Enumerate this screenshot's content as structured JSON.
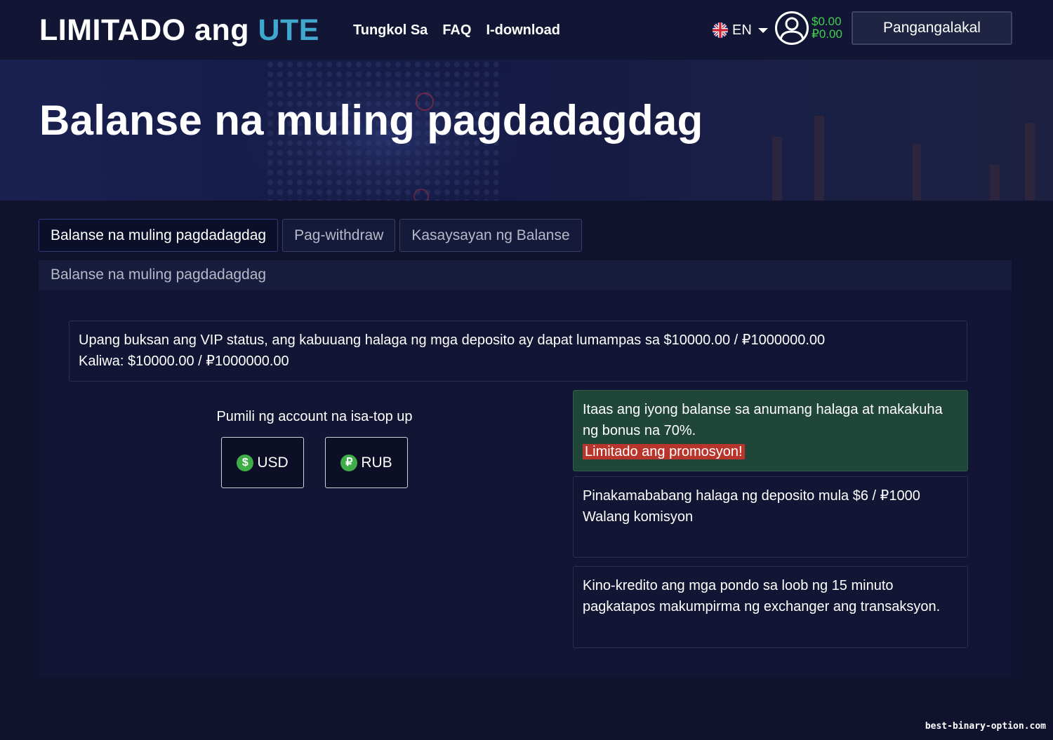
{
  "header": {
    "logo_main": "LIMITADO ang ",
    "logo_accent": "UTE",
    "nav": [
      "Tungkol Sa",
      "FAQ",
      "I-download"
    ],
    "language": "EN",
    "balance_usd": "$0.00",
    "balance_rub": "₽0.00",
    "trade_button": "Pangangalakal",
    "icons": {
      "flag": "uk-flag-icon",
      "caret": "caret-down-icon",
      "avatar": "user-avatar-icon"
    }
  },
  "hero": {
    "title": "Balanse na muling pagdadagdag"
  },
  "tabs": [
    {
      "label": "Balanse na muling pagdadagdag",
      "active": true
    },
    {
      "label": "Pag-withdraw",
      "active": false
    },
    {
      "label": "Kasaysayan ng Balanse",
      "active": false
    }
  ],
  "panel": {
    "heading": "Balanse na muling pagdadagdag",
    "vip_line1": "Upang buksan ang VIP status, ang kabuuang halaga ng mga deposito ay dapat lumampas sa $10000.00 / ₽1000000.00",
    "vip_line2": "Kaliwa: $10000.00 / ₽1000000.00",
    "select_label": "Pumili ng account na isa-top up",
    "currencies": [
      {
        "symbol": "$",
        "code": "USD"
      },
      {
        "symbol": "₽",
        "code": "RUB"
      }
    ],
    "bonus_text": "Itaas ang iyong balanse sa anumang halaga at makakuha ng bonus na 70%.",
    "bonus_promo": "Limitado ang promosyon!",
    "min_deposit": "Pinakamababang halaga ng deposito mula $6 / ₽1000",
    "no_commission": "Walang komisyon",
    "credit_time": "Kino-kredito ang mga pondo sa loob ng 15 minuto pagkatapos makumpirma ng exchanger ang transaksyon."
  },
  "watermark": "best-binary-option.com",
  "colors": {
    "background": "#10122e",
    "logo_accent": "#3fa8cc",
    "balance_green": "#3ecf4f",
    "bonus_box": "#1f4638",
    "promo_red": "#b8352b",
    "coin_green": "#3fae49"
  }
}
